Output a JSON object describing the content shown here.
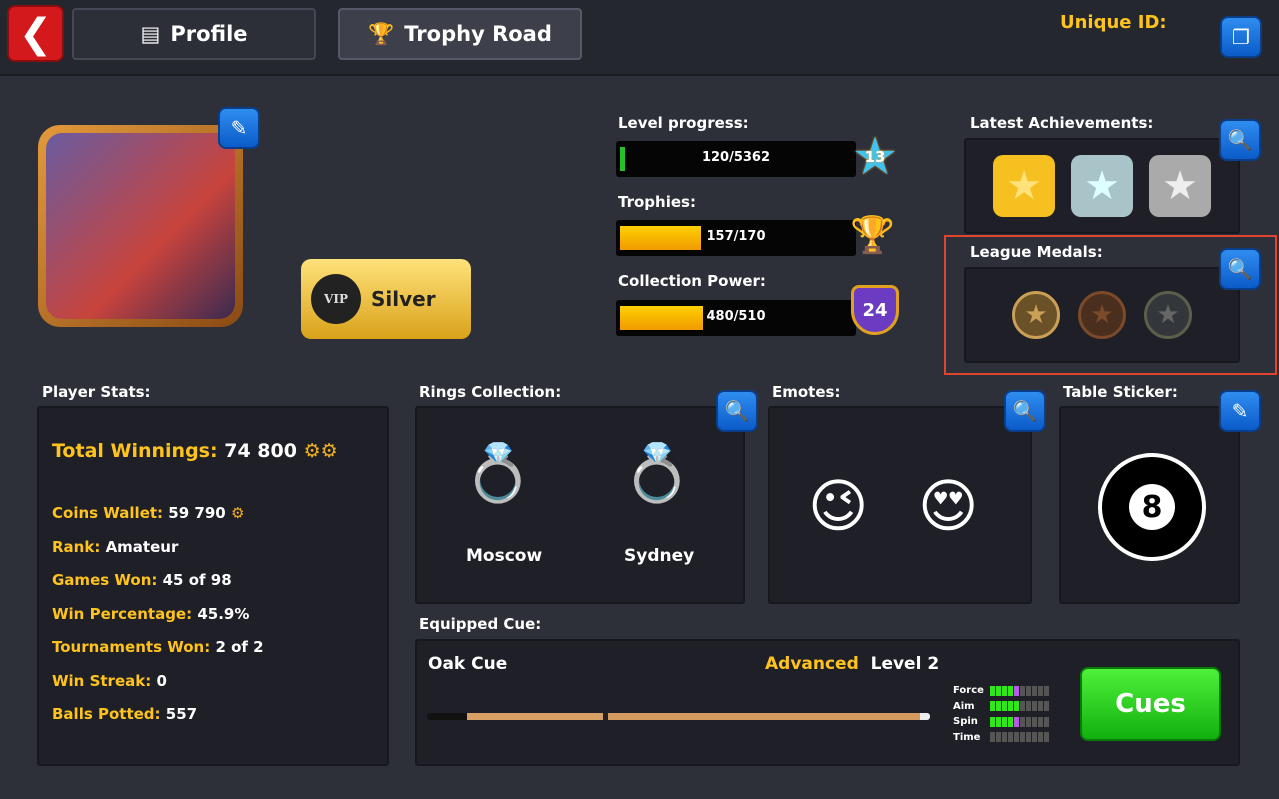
{
  "header": {
    "back_icon": "chevron-left-icon",
    "tabs": [
      {
        "label": "Profile",
        "icon": "profile-card-icon"
      },
      {
        "label": "Trophy Road",
        "icon": "trophy-icon"
      }
    ],
    "unique_id_label": "Unique ID:",
    "copy_icon": "copy-icon"
  },
  "profile": {
    "vip_label": "VIP",
    "vip_tier": "Silver",
    "edit_icon": "pencil-icon"
  },
  "progress": {
    "level": {
      "label": "Level progress:",
      "text": "120/5362",
      "value": 120,
      "max": 5362,
      "badge": "13"
    },
    "trophies": {
      "label": "Trophies:",
      "text": "157/170",
      "value": 157,
      "max": 170
    },
    "collection": {
      "label": "Collection Power:",
      "text": "480/510",
      "value": 480,
      "max": 510,
      "badge": "24"
    }
  },
  "achievements": {
    "label": "Latest Achievements:"
  },
  "league": {
    "label": "League Medals:"
  },
  "stats": {
    "title": "Player Stats:",
    "total_label": "Total Winnings:",
    "total_value": "74 800",
    "rows": [
      {
        "k": "Coins Wallet:",
        "v": "59 790"
      },
      {
        "k": "Rank:",
        "v": "Amateur"
      },
      {
        "k": "Games Won:",
        "v": "45 of 98"
      },
      {
        "k": "Win Percentage:",
        "v": "45.9%"
      },
      {
        "k": "Tournaments Won:",
        "v": "2 of 2"
      },
      {
        "k": "Win Streak:",
        "v": "0"
      },
      {
        "k": "Balls Potted:",
        "v": "557"
      }
    ]
  },
  "rings": {
    "title": "Rings Collection:",
    "items": [
      "Moscow",
      "Sydney"
    ]
  },
  "emotes": {
    "title": "Emotes:",
    "items": [
      "😉",
      "😍"
    ]
  },
  "sticker": {
    "title": "Table Sticker:",
    "ball": "8"
  },
  "cue": {
    "title": "Equipped Cue:",
    "name": "Oak Cue",
    "tier": "Advanced",
    "level": "Level 2",
    "button": "Cues",
    "stats": [
      {
        "name": "Force",
        "green": 4,
        "purple": 1
      },
      {
        "name": "Aim",
        "green": 5,
        "purple": 0
      },
      {
        "name": "Spin",
        "green": 4,
        "purple": 1
      },
      {
        "name": "Time",
        "green": 0,
        "purple": 0
      }
    ]
  },
  "colors": {
    "accent_yellow": "#ffc31e",
    "highlight": "#e0452f",
    "button_green": "#1ec21a"
  }
}
